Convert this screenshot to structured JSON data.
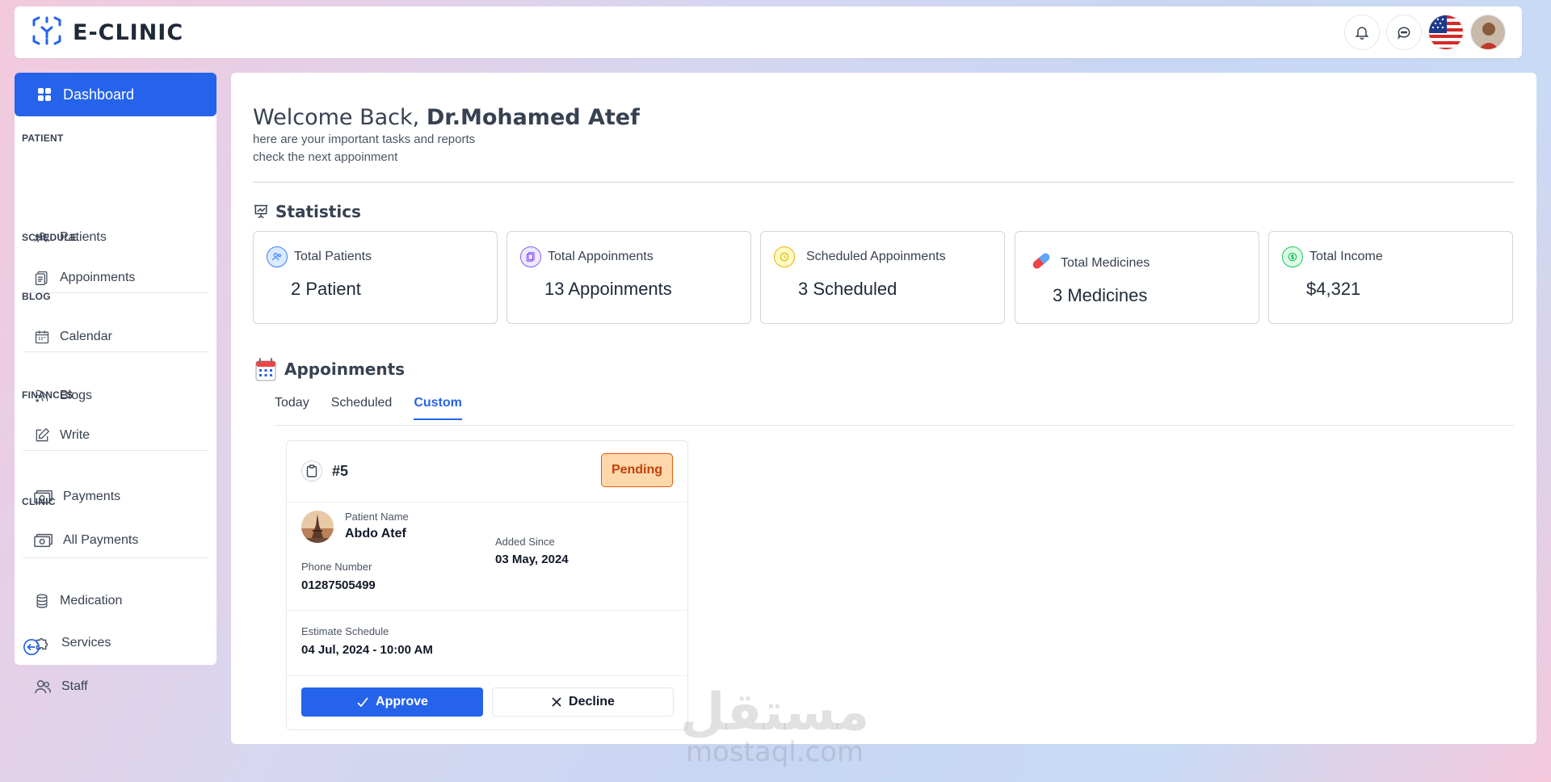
{
  "brand": {
    "name": "E-CLINIC"
  },
  "sidebar": {
    "active": {
      "label": "Dashboard"
    },
    "sections": [
      {
        "title": "PATIENT",
        "items": [
          {
            "label": "Patients"
          },
          {
            "label": "Appoinments"
          }
        ]
      },
      {
        "title": "SCHEDULE",
        "items": [
          {
            "label": "Calendar"
          }
        ]
      },
      {
        "title": "BLOG",
        "items": [
          {
            "label": "Blogs"
          },
          {
            "label": "Write"
          }
        ]
      },
      {
        "title": "FINANCES",
        "items": [
          {
            "label": "Payments"
          },
          {
            "label": "All Payments"
          }
        ]
      },
      {
        "title": "CLINIC",
        "items": [
          {
            "label": "Medication"
          },
          {
            "label": "Services"
          },
          {
            "label": "Staff"
          }
        ]
      }
    ]
  },
  "welcome": {
    "prefix": "Welcome Back,",
    "name": "Dr.Mohamed Atef",
    "line1": "here are your important tasks and reports",
    "line2": "check the next appoinment"
  },
  "statistics": {
    "title": "Statistics",
    "cards": [
      {
        "label": "Total Patients",
        "value": "2 Patient"
      },
      {
        "label": "Total Appoinments",
        "value": "13 Appoinments"
      },
      {
        "label": "Scheduled Appoinments",
        "value": "3 Scheduled"
      },
      {
        "label": "Total Medicines",
        "value": "3 Medicines"
      },
      {
        "label": "Total Income",
        "value": "$4,321"
      }
    ]
  },
  "appointments": {
    "title": "Appoinments",
    "tabs": [
      {
        "label": "Today"
      },
      {
        "label": "Scheduled"
      },
      {
        "label": "Custom"
      }
    ],
    "card": {
      "id": "#5",
      "status": "Pending",
      "patient_label": "Patient Name",
      "patient_name": "Abdo Atef",
      "added_label": "Added Since",
      "added_value": "03 May, 2024",
      "phone_label": "Phone Number",
      "phone_value": "01287505499",
      "schedule_label": "Estimate Schedule",
      "schedule_value": "04 Jul, 2024 - 10:00 AM",
      "approve": "Approve",
      "decline": "Decline"
    }
  },
  "watermark": {
    "arabic": "مستقل",
    "latin": "mostaql.com"
  },
  "colors": {
    "primary": "#2563eb",
    "pending_bg": "#fed7aa",
    "pending_text": "#c2410c"
  }
}
